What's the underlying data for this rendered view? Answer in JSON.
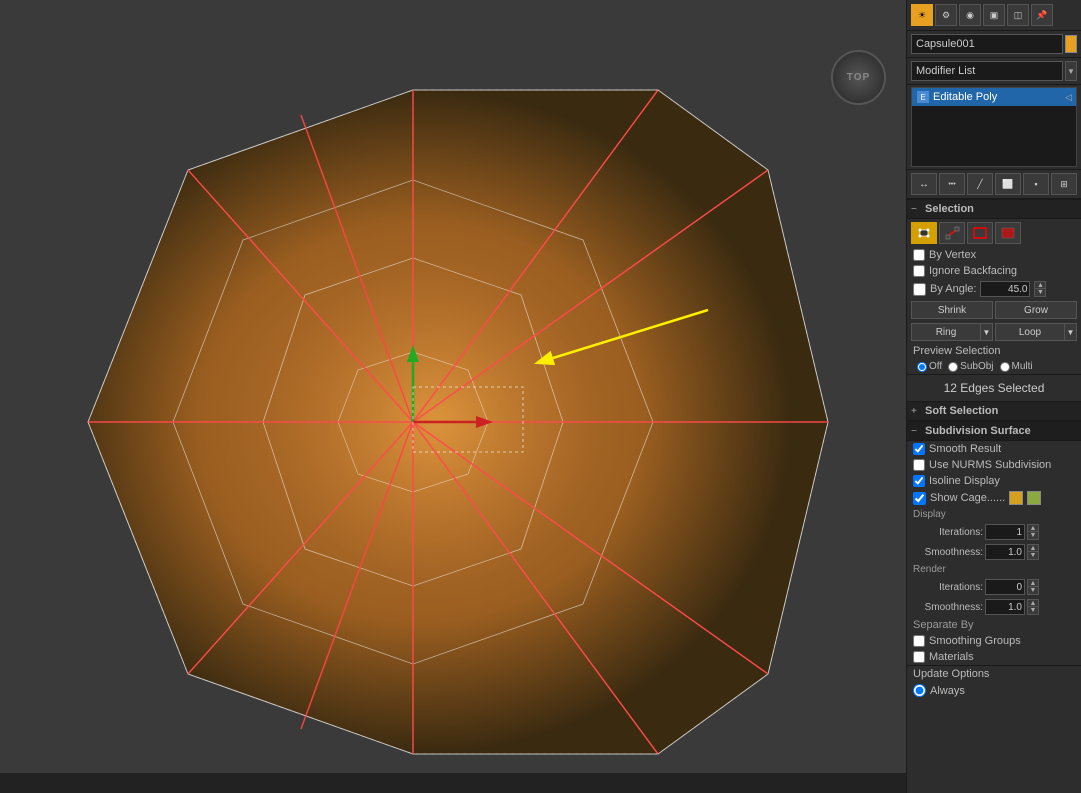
{
  "viewport": {
    "label": "TOP",
    "bg_color": "#3a3a3a"
  },
  "topToolbar": {
    "icons": [
      {
        "name": "hierarchy-icon",
        "symbol": "☀",
        "active": true
      },
      {
        "name": "motion-icon",
        "symbol": "⚙",
        "active": false
      },
      {
        "name": "display-icon",
        "symbol": "👁",
        "active": false
      },
      {
        "name": "utilities-icon",
        "symbol": "🔧",
        "active": false
      },
      {
        "name": "extras-icon",
        "symbol": "▤",
        "active": false
      },
      {
        "name": "pin-icon",
        "symbol": "📌",
        "active": false
      }
    ]
  },
  "objectName": {
    "value": "Capsule001",
    "color": "#e8a020"
  },
  "modifierList": {
    "label": "Modifier List",
    "items": [
      {
        "name": "Editable Poly",
        "icon": "E",
        "selected": true
      }
    ]
  },
  "subObjToolbar": {
    "icons": [
      {
        "name": "move-icon",
        "symbol": "↔",
        "tooltip": "Move"
      },
      {
        "name": "vertex-icon",
        "symbol": "·",
        "tooltip": "Vertex"
      },
      {
        "name": "edge-icon",
        "symbol": "/",
        "tooltip": "Edge"
      },
      {
        "name": "border-icon",
        "symbol": "◻",
        "tooltip": "Border"
      },
      {
        "name": "polygon-icon",
        "symbol": "▣",
        "tooltip": "Polygon"
      },
      {
        "name": "element-icon",
        "symbol": "◈",
        "tooltip": "Element"
      }
    ]
  },
  "selection": {
    "title": "Selection",
    "icons": [
      {
        "name": "vertex-sel-icon",
        "symbol": "⬛",
        "active": true,
        "color": "#d4a000"
      },
      {
        "name": "edge-sel-icon",
        "symbol": "/",
        "active": false
      },
      {
        "name": "border-sel-icon",
        "symbol": "◻",
        "active": false
      },
      {
        "name": "polygon-sel-icon",
        "symbol": "▣",
        "active": false
      }
    ],
    "byVertex": {
      "label": "By Vertex",
      "checked": false
    },
    "ignoreBackfacing": {
      "label": "Ignore Backfacing",
      "checked": false
    },
    "byAngle": {
      "label": "By Angle:",
      "checked": false,
      "value": "45.0"
    },
    "shrinkBtn": "Shrink",
    "growBtn": "Grow",
    "ringBtn": "Ring",
    "loopBtn": "Loop",
    "previewLabel": "Preview Selection",
    "previewOptions": [
      "Off",
      "SubObj",
      "Multi"
    ],
    "previewSelected": "Off",
    "edgesSelected": "12 Edges Selected"
  },
  "softSelection": {
    "title": "Soft Selection",
    "collapsed": true
  },
  "subdivisionSurface": {
    "title": "Subdivision Surface",
    "collapsed": false,
    "smoothResult": {
      "label": "Smooth Result",
      "checked": true
    },
    "useNURMS": {
      "label": "Use NURMS Subdivision",
      "checked": false
    },
    "isolineDisplay": {
      "label": "Isoline Display",
      "checked": true
    },
    "showCage": {
      "label": "Show Cage......",
      "checked": true,
      "color1": "#d4a020",
      "color2": "#8aaa40"
    },
    "display": {
      "label": "Display",
      "iterations": {
        "label": "Iterations:",
        "value": "1"
      },
      "smoothness": {
        "label": "Smoothness:",
        "value": "1.0"
      }
    },
    "render": {
      "label": "Render",
      "iterations": {
        "label": "Iterations:",
        "value": "0"
      },
      "smoothness": {
        "label": "Smoothness:",
        "value": "1.0"
      }
    }
  },
  "separateBy": {
    "title": "Separate By",
    "smoothingGroups": {
      "label": "Smoothing Groups",
      "checked": false
    },
    "materials": {
      "label": "Materials",
      "checked": false
    }
  },
  "updateOptions": {
    "title": "Update Options",
    "label": "Always"
  }
}
